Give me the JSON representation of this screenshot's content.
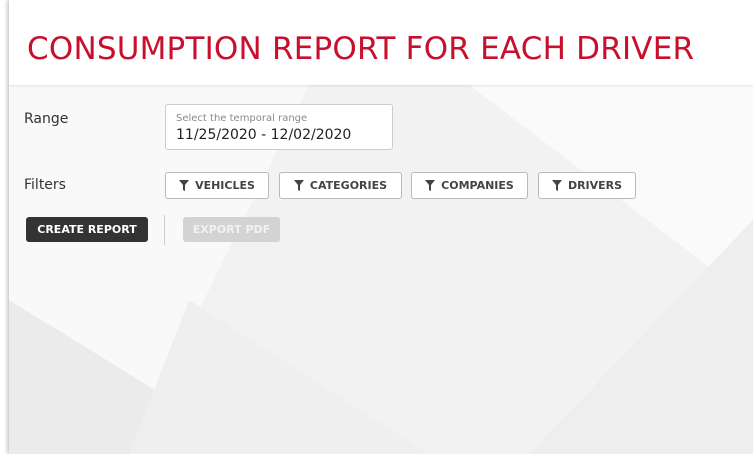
{
  "page": {
    "title": "CONSUMPTION REPORT FOR EACH DRIVER"
  },
  "range": {
    "label": "Range",
    "placeholder": "Select the temporal range",
    "value": "11/25/2020 - 12/02/2020"
  },
  "filters": {
    "label": "Filters",
    "vehicles": "VEHICLES",
    "categories": "CATEGORIES",
    "companies": "COMPANIES",
    "drivers": "DRIVERS"
  },
  "actions": {
    "create_report": "CREATE REPORT",
    "export_pdf": "EXPORT PDF"
  },
  "colors": {
    "title": "#c8102e",
    "primary_button": "#333333",
    "disabled_button": "#d3d3d3",
    "filter_icon": "funnel-icon"
  }
}
